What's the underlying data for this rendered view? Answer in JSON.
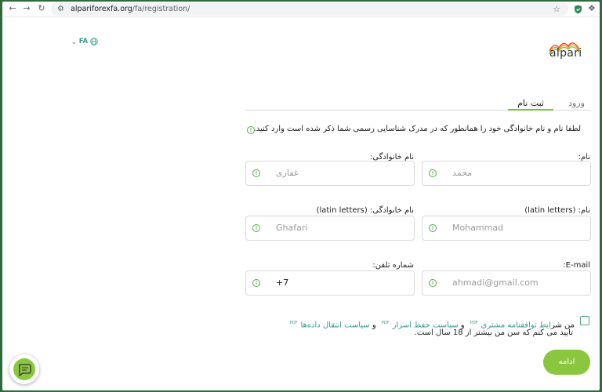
{
  "browser": {
    "url_host": "alpariforexfa.org",
    "url_path": "/fa/registration/",
    "icons": [
      "back-icon",
      "forward-icon",
      "reload-icon",
      "site-settings-icon",
      "bookmark-star-icon",
      "extension-shield-icon",
      "extensions-puzzle-icon"
    ]
  },
  "header": {
    "language": "FA",
    "logo_text": "alpari"
  },
  "tabs": {
    "login": "ورود",
    "register": "ثبت نام"
  },
  "form": {
    "instruction": "لطفا نام و نام خانوادگی خود را همانطور که در مدرک شناسایی رسمی شما ذکر شده است وارد کنید.",
    "first_name_label": "نام:",
    "first_name_value": "محمد",
    "last_name_label": "نام خانوادگی:",
    "last_name_value": "غفاری",
    "first_name_latin_label": "نام: (latin letters)",
    "first_name_latin_value": "Mohammad",
    "last_name_latin_label": "نام خانوادگی: (latin letters)",
    "last_name_latin_value": "Ghafari",
    "email_label": "E-mail:",
    "email_placeholder": "ahmadi@gmail.com",
    "phone_label": "شماره تلفن:",
    "phone_value": "+7"
  },
  "terms": {
    "prefix": "من شر",
    "link1": "ایط توافقنامه مشتری",
    "and1": " و ",
    "link2": "سیاست حفظ اسرار",
    "and2": " و ",
    "link3": "سیاست انتقال داده‌ها",
    "pdf": "PDF",
    "line2": "تایید می کنم که سن من بیشتر از 18 سال است."
  },
  "actions": {
    "continue": "ادامه"
  },
  "colors": {
    "accent_green": "#8bc63f",
    "link_teal": "#3a9a8f",
    "frame_green": "#2d6b3c"
  }
}
